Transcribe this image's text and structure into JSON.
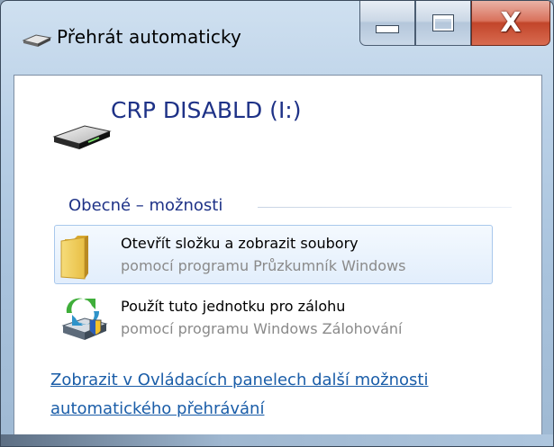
{
  "window": {
    "title": "Přehrát automaticky",
    "title_icon": "autoplay-drive-icon",
    "buttons": {
      "minimize_icon": "minimize-icon",
      "maximize_icon": "maximize-icon",
      "close_icon": "close-icon",
      "close_glyph": "X"
    }
  },
  "drive": {
    "name": "CRP DISABLD (I:)",
    "icon": "removable-drive-icon"
  },
  "section": {
    "heading": "Obecné – možnosti"
  },
  "options": [
    {
      "main": "Otevřít složku a zobrazit soubory",
      "sub": "pomocí programu Průzkumník Windows",
      "icon": "folder-icon",
      "selected": true
    },
    {
      "main": "Použít tuto jednotku pro zálohu",
      "sub": "pomocí programu Windows Zálohování",
      "icon": "backup-icon",
      "selected": false
    }
  ],
  "link": {
    "line1": "Zobrazit v Ovládacích panelech další možnosti",
    "line2": "automatického přehrávání"
  },
  "colors": {
    "heading_blue": "#1e3287",
    "link_blue": "#1a5da8",
    "close_red": "#c2452a",
    "selection_border": "#a9c8ec"
  }
}
